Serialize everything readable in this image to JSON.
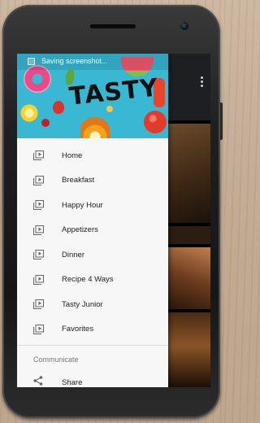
{
  "status_bar": {
    "notification_text": "Saving screenshot..."
  },
  "header": {
    "brand": "TASTY"
  },
  "menu": {
    "items": [
      {
        "label": "Home",
        "icon": "video-library-icon"
      },
      {
        "label": "Breakfast",
        "icon": "video-library-icon"
      },
      {
        "label": "Happy Hour",
        "icon": "video-library-icon"
      },
      {
        "label": "Appetizers",
        "icon": "video-library-icon"
      },
      {
        "label": "Dinner",
        "icon": "video-library-icon"
      },
      {
        "label": "Recipe 4 Ways",
        "icon": "video-library-icon"
      },
      {
        "label": "Tasty Junior",
        "icon": "video-library-icon"
      },
      {
        "label": "Favorites",
        "icon": "video-library-icon"
      }
    ]
  },
  "communicate": {
    "title": "Communicate",
    "share_label": "Share"
  },
  "colors": {
    "header_accent": "#39b7d3",
    "drawer_background": "#f7f7f7",
    "toolbar_background": "#1d1f23"
  }
}
